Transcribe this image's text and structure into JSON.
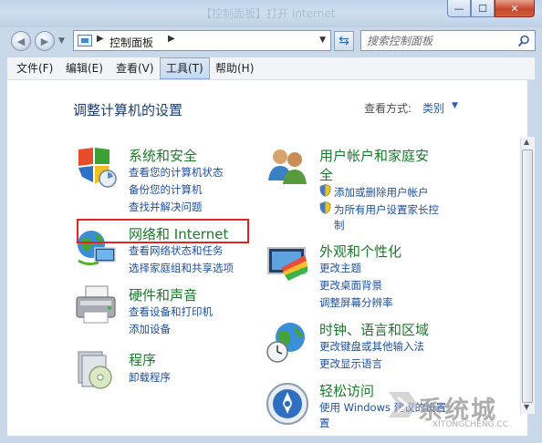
{
  "window": {
    "ghost_title": "【控制面板】打开 Internet",
    "buttons": {
      "minimize": "—",
      "maximize": "☐",
      "close": "✕"
    }
  },
  "navigation": {
    "address_crumb": "控制面板",
    "search_placeholder": "搜索控制面板"
  },
  "menu": {
    "items": [
      {
        "label": "文件(F)"
      },
      {
        "label": "编辑(E)"
      },
      {
        "label": "查看(V)"
      },
      {
        "label": "工具(T)"
      },
      {
        "label": "帮助(H)"
      }
    ]
  },
  "page": {
    "heading": "调整计算机的设置",
    "view_by_label": "查看方式:",
    "view_by_value": "类别"
  },
  "categories": {
    "system": {
      "title": "系统和安全",
      "links": [
        "查看您的计算机状态",
        "备份您的计算机",
        "查找并解决问题"
      ]
    },
    "network": {
      "title": "网络和 Internet",
      "links": [
        "查看网络状态和任务",
        "选择家庭组和共享选项"
      ]
    },
    "hardware": {
      "title": "硬件和声音",
      "links": [
        "查看设备和打印机",
        "添加设备"
      ]
    },
    "programs": {
      "title": "程序",
      "links": [
        "卸载程序"
      ]
    },
    "users": {
      "title_line1": "用户帐户和家庭安",
      "title_line2": "全",
      "links": [
        "添加或删除用户帐户",
        "为所有用户设置家长控",
        "制"
      ]
    },
    "appearance": {
      "title": "外观和个性化",
      "links": [
        "更改主题",
        "更改桌面背景",
        "调整屏幕分辨率"
      ]
    },
    "clock": {
      "title": "时钟、语言和区域",
      "links": [
        "更改键盘或其他输入法",
        "更改显示语言"
      ]
    },
    "ease": {
      "title": "轻松访问",
      "links": [
        "使用 Windows 建议的设置",
        "置"
      ]
    }
  },
  "watermark": {
    "text": "系统城",
    "url": "XITONGCHENG.CC"
  },
  "colors": {
    "category_title": "#1b7a2c",
    "link": "#1e4f9e",
    "heading": "#1e3d6e",
    "highlight_box": "#e02525"
  }
}
